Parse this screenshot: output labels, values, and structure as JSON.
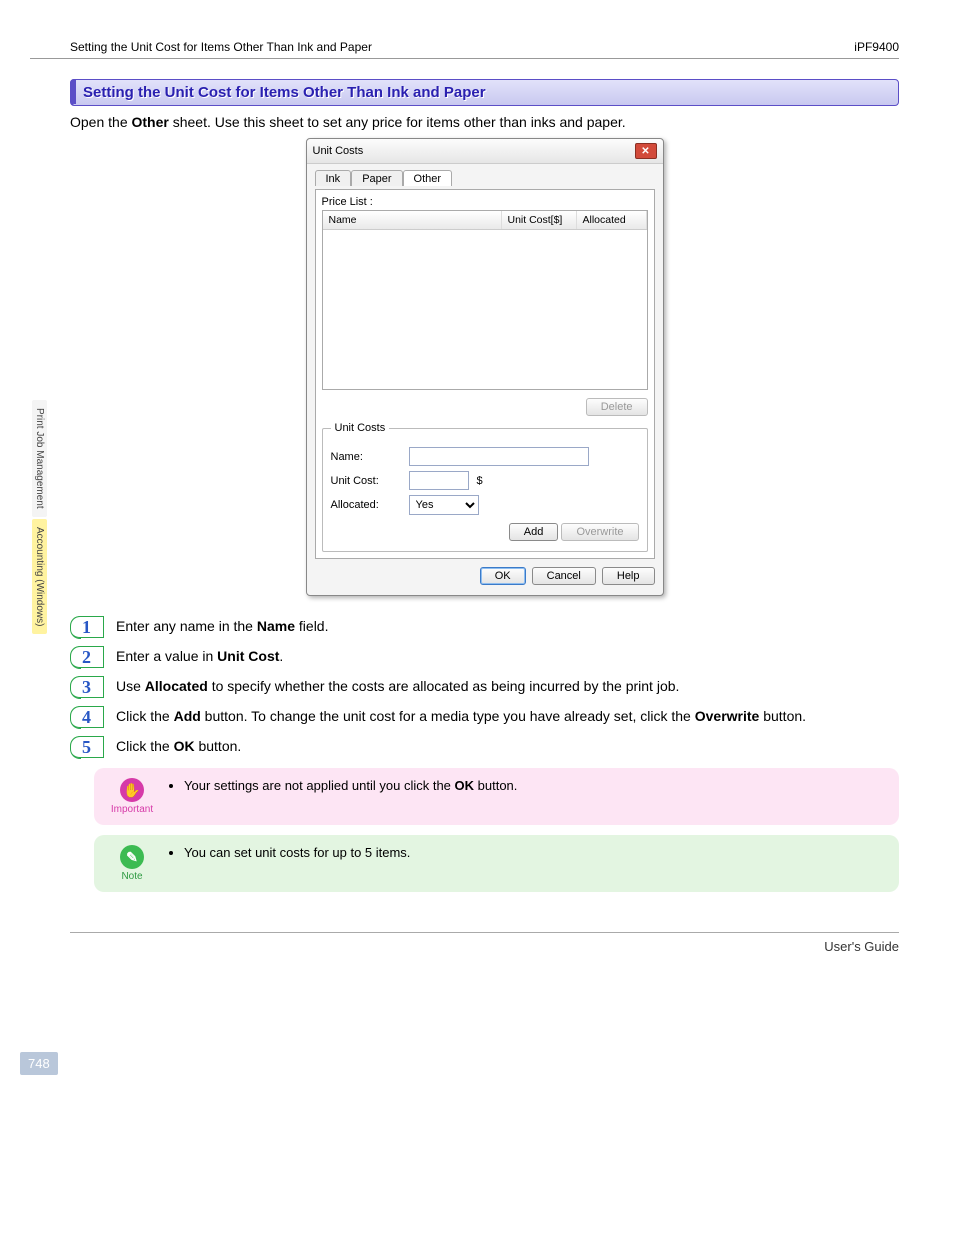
{
  "header": {
    "breadcrumb": "Setting the Unit Cost for Items Other Than Ink and Paper",
    "model": "iPF9400"
  },
  "side_tabs": {
    "tab1": "Print Job Management",
    "tab2": "Accounting (Windows)"
  },
  "section": {
    "heading": "Setting the Unit Cost for Items Other Than Ink and Paper",
    "intro_pre": "Open the ",
    "intro_bold": "Other",
    "intro_post": " sheet. Use this sheet to set any price for items other than inks and paper."
  },
  "dialog": {
    "title": "Unit Costs",
    "tabs": {
      "ink": "Ink",
      "paper": "Paper",
      "other": "Other"
    },
    "price_list_label": "Price List :",
    "columns": {
      "name": "Name",
      "unit_cost": "Unit Cost[$]",
      "allocated": "Allocated"
    },
    "delete_btn": "Delete",
    "group_title": "Unit Costs",
    "name_label": "Name:",
    "unit_cost_label": "Unit Cost:",
    "currency": "$",
    "allocated_label": "Allocated:",
    "allocated_value": "Yes",
    "add_btn": "Add",
    "overwrite_btn": "Overwrite",
    "ok_btn": "OK",
    "cancel_btn": "Cancel",
    "help_btn": "Help"
  },
  "steps": {
    "s1": {
      "num": "1",
      "pre": "Enter any name in the ",
      "b": "Name",
      "post": " field."
    },
    "s2": {
      "num": "2",
      "pre": "Enter a value in ",
      "b": "Unit Cost",
      "post": "."
    },
    "s3": {
      "num": "3",
      "pre": "Use ",
      "b": "Allocated",
      "post": " to specify whether the costs are allocated as being incurred by the print job."
    },
    "s4": {
      "num": "4",
      "pre": "Click the ",
      "b1": "Add",
      "mid": " button. To change the unit cost for a media type you have already set, click the ",
      "b2": "Overwrite",
      "post": " button."
    },
    "s5": {
      "num": "5",
      "pre": "Click the ",
      "b": "OK",
      "post": " button."
    }
  },
  "callouts": {
    "important_label": "Important",
    "important_text_pre": "Your settings are not applied until you click the ",
    "important_text_b": "OK",
    "important_text_post": " button.",
    "note_label": "Note",
    "note_text": "You can set unit costs for up to 5 items."
  },
  "page_number": "748",
  "footer": "User's Guide"
}
